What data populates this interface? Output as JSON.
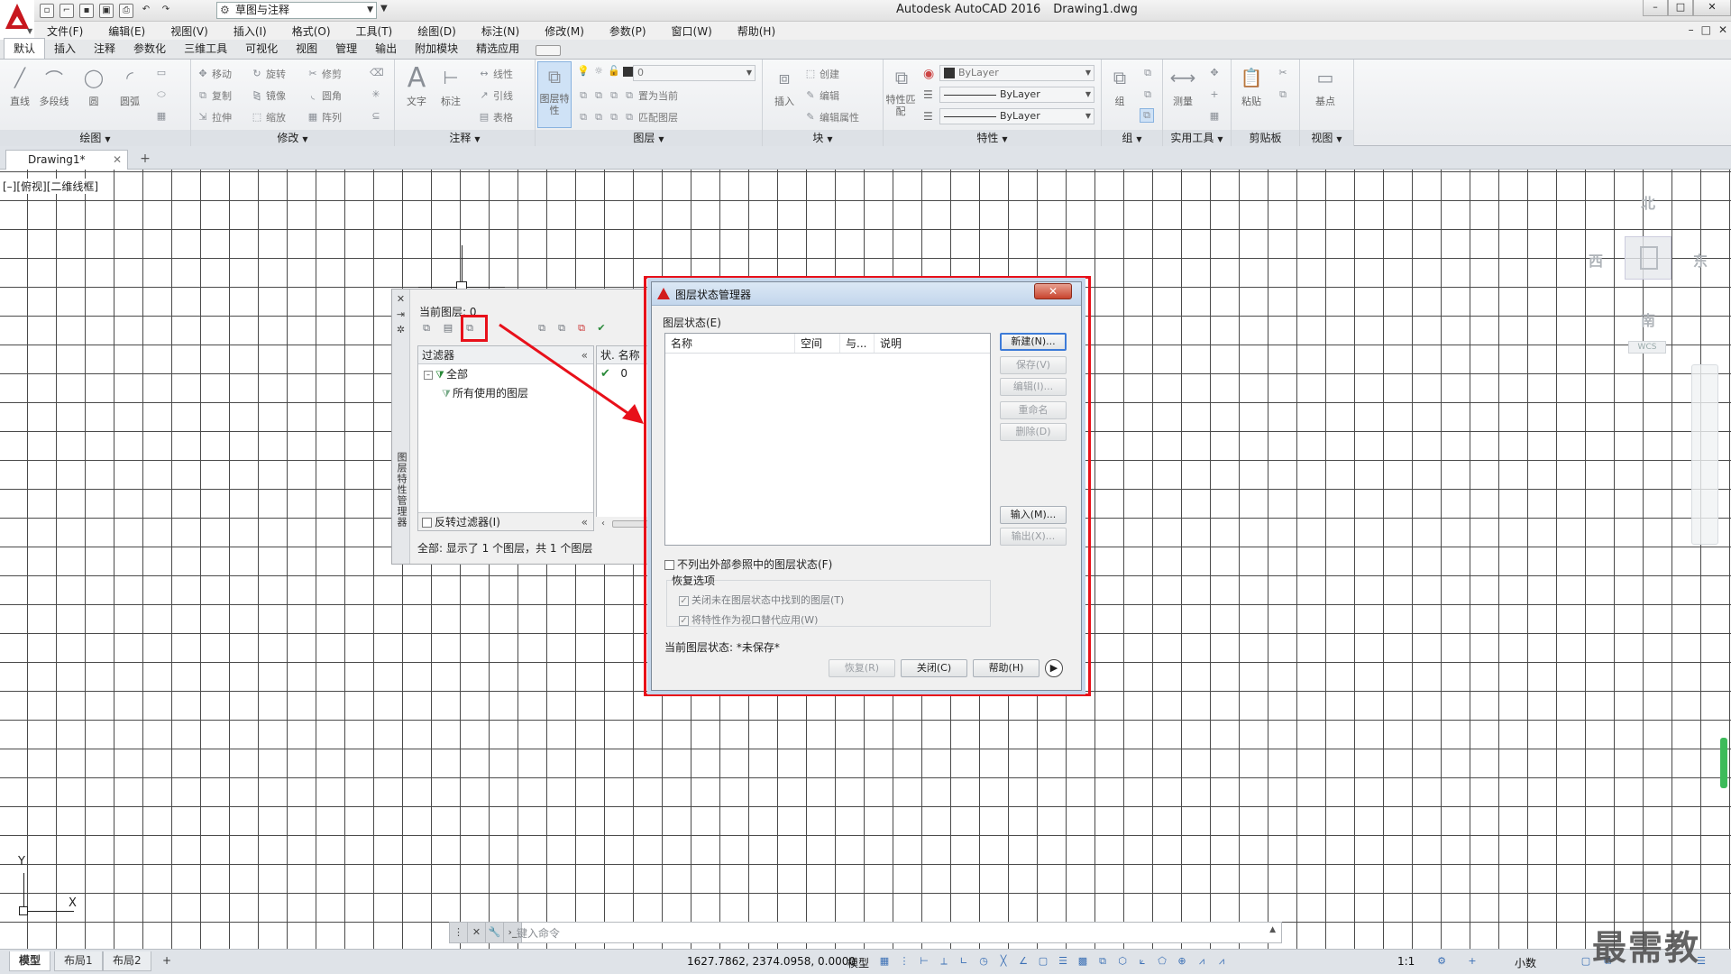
{
  "window": {
    "app_name": "Autodesk AutoCAD 2016",
    "file_name": "Drawing1.dwg",
    "workspace": "草图与注释",
    "controls": [
      "–",
      "□",
      "✕"
    ]
  },
  "menu": [
    "文件(F)",
    "编辑(E)",
    "视图(V)",
    "插入(I)",
    "格式(O)",
    "工具(T)",
    "绘图(D)",
    "标注(N)",
    "修改(M)",
    "参数(P)",
    "窗口(W)",
    "帮助(H)"
  ],
  "ribbon_tabs": [
    "默认",
    "插入",
    "注释",
    "参数化",
    "三维工具",
    "可视化",
    "视图",
    "管理",
    "输出",
    "附加模块",
    "精选应用"
  ],
  "ribbon": {
    "draw": {
      "title": "绘图",
      "tools": [
        "直线",
        "多段线",
        "圆",
        "圆弧"
      ]
    },
    "modify": {
      "title": "修改",
      "tools": [
        "移动",
        "旋转",
        "修剪",
        "复制",
        "镜像",
        "圆角",
        "拉伸",
        "缩放",
        "阵列"
      ]
    },
    "annotation": {
      "title": "注释",
      "tools": [
        "文字",
        "标注",
        "线性",
        "引线",
        "表格"
      ]
    },
    "layers": {
      "title": "图层",
      "big_tool": "图层特性",
      "current_layer": "0",
      "tools": [
        "置为当前",
        "匹配图层"
      ]
    },
    "block": {
      "title": "块",
      "tools": [
        "插入",
        "创建",
        "编辑",
        "编辑属性"
      ]
    },
    "properties": {
      "title": "特性",
      "big_tool": "特性匹配",
      "color": "ByLayer",
      "linetype": "ByLayer",
      "lineweight": "ByLayer"
    },
    "groups": {
      "title": "组",
      "tools": [
        "组"
      ]
    },
    "utilities": {
      "title": "实用工具",
      "tools": [
        "测量"
      ]
    },
    "clipboard": {
      "title": "剪贴板",
      "tools": [
        "粘贴"
      ]
    },
    "view": {
      "title": "视图",
      "tools": [
        "基点"
      ]
    }
  },
  "file_tab": {
    "name": "Drawing1*",
    "close": "✕",
    "new": "+"
  },
  "viewport": {
    "label": "[–][俯视][二维线框]",
    "compass": {
      "north": "北",
      "south": "南",
      "east": "东",
      "west": "西"
    },
    "wcs": "WCS",
    "ucs": {
      "x": "X",
      "y": "Y"
    }
  },
  "layer_palette": {
    "title_vertical": "图层特性管理器",
    "current_layer": "当前图层: 0",
    "filters_header": "过滤器",
    "tree": [
      "全部",
      "所有使用的图层"
    ],
    "invert_filter": "反转过滤器(I)",
    "columns": [
      "状.",
      "名称"
    ],
    "row": {
      "status": "✔",
      "name": "0"
    },
    "status_text": "全部: 显示了 1 个图层，共 1 个图层"
  },
  "dialog": {
    "title": "图层状态管理器",
    "close": "✕",
    "group_label": "图层状态(E)",
    "columns": [
      "名称",
      "空间",
      "与...",
      "说明"
    ],
    "buttons": {
      "new": "新建(N)...",
      "save": "保存(V)",
      "edit": "编辑(I)...",
      "rename": "重命名",
      "delete": "删除(D)",
      "import": "输入(M)...",
      "export": "输出(X)..."
    },
    "no_xref": "不列出外部参照中的图层状态(F)",
    "restore_options_label": "恢复选项",
    "option_1": "关闭未在图层状态中找到的图层(T)",
    "option_2": "将特性作为视口替代应用(W)",
    "current_state": "当前图层状态: *未保存*",
    "footer": {
      "restore": "恢复(R)",
      "close": "关闭(C)",
      "help": "帮助(H)"
    }
  },
  "command_line": {
    "placeholder": "键入命令"
  },
  "status_bar": {
    "layout_tabs": [
      "模型",
      "布局1",
      "布局2"
    ],
    "add_tab": "+",
    "coordinates": "1627.7862, 2374.0958, 0.0000",
    "model": "模型",
    "scale": "1:1",
    "units": "小数"
  },
  "watermark": "最需教育",
  "colors": {
    "highlight": "#e8101a",
    "brand": "#c8171e",
    "status_on": "#3a6fb5"
  }
}
